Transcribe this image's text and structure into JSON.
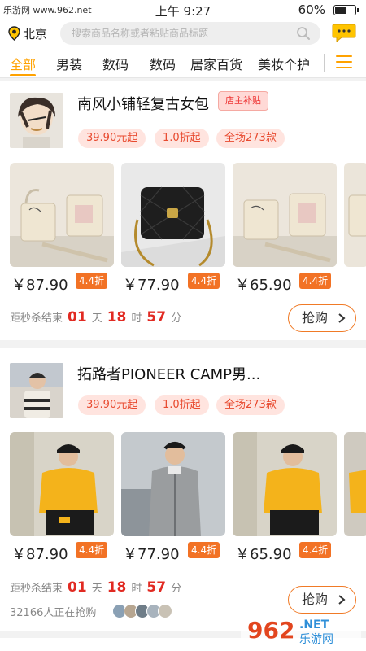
{
  "status_bar": {
    "carrier": "乐游网 www.962.net",
    "time": "上午 9:27",
    "battery_percent": "60%",
    "battery_level": 0.6
  },
  "header": {
    "city": "北京",
    "search_placeholder": "搜索商品名称或者粘贴商品标题"
  },
  "tabs": [
    "全部",
    "男装",
    "数码",
    "数码",
    "居家百货",
    "美妆个护"
  ],
  "active_tab": 0,
  "colors": {
    "accent": "#ffa200",
    "price_red": "#e12a22",
    "discount_orange": "#f27225"
  },
  "cards": [
    {
      "shop_name": "南风小铺轻复古女包",
      "subsidy_badge": "店主补贴",
      "tags": [
        "39.90元起",
        "1.0折起",
        "全场273款"
      ],
      "products": [
        {
          "price": "￥87.90",
          "discount": "4.4折"
        },
        {
          "price": "￥77.90",
          "discount": "4.4折"
        },
        {
          "price": "￥65.90",
          "discount": "4.4折"
        }
      ],
      "countdown": {
        "label": "距秒杀结束",
        "days": "01",
        "day_unit": "天",
        "hours": "18",
        "hour_unit": "时",
        "minutes": "57",
        "minute_unit": "分"
      },
      "grab_button": "抢购"
    },
    {
      "shop_name": "拓路者PIONEER CAMP男...",
      "tags": [
        "39.90元起",
        "1.0折起",
        "全场273款"
      ],
      "products": [
        {
          "price": "￥87.90",
          "discount": "4.4折"
        },
        {
          "price": "￥77.90",
          "discount": "4.4折"
        },
        {
          "price": "￥65.90",
          "discount": "4.4折"
        }
      ],
      "countdown": {
        "label": "距秒杀结束",
        "days": "01",
        "day_unit": "天",
        "hours": "18",
        "hour_unit": "时",
        "minutes": "57",
        "minute_unit": "分"
      },
      "grab_button": "抢购",
      "people_buying": "32166人正在抢购"
    }
  ],
  "watermark": {
    "brand": "962",
    "site": "乐游网",
    "suffix": ".NET"
  }
}
